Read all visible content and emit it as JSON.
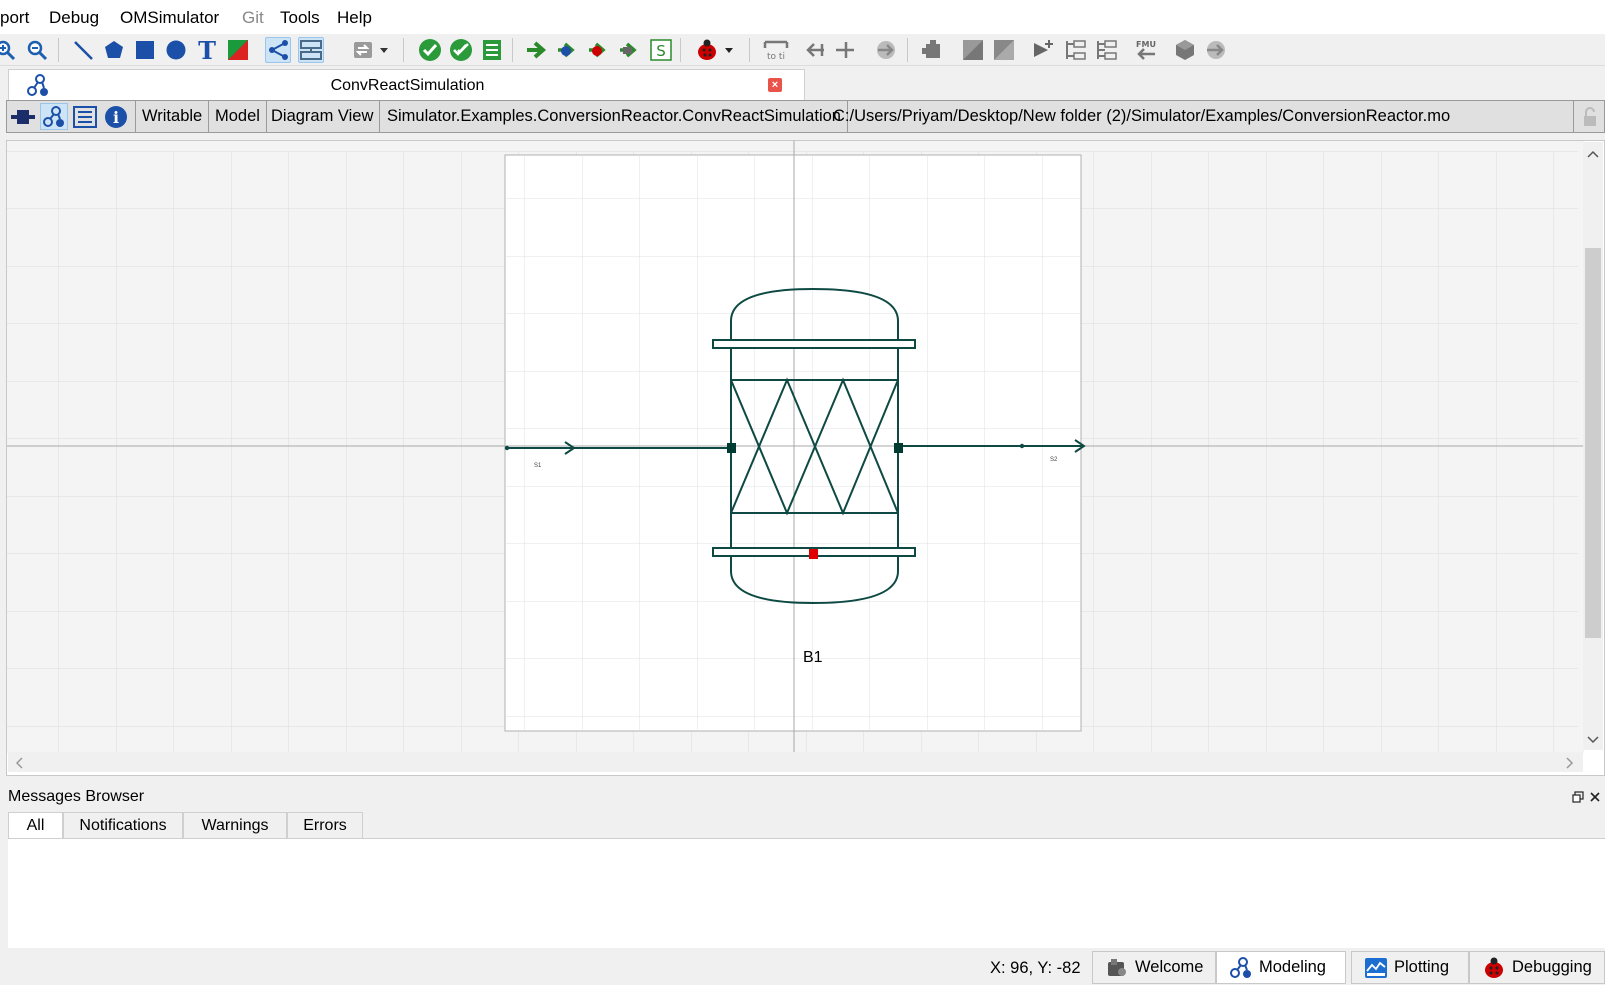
{
  "menu": {
    "items": [
      "port",
      "Debug",
      "OMSimulator",
      "Git",
      "Tools",
      "Help"
    ]
  },
  "tab": {
    "title": "ConvReactSimulation",
    "close_glyph": "×"
  },
  "infobar": {
    "access": "Writable",
    "restriction": "Model",
    "view": "Diagram View",
    "class_name": "Simulator.Examples.ConversionReactor.ConvReactSimulation",
    "file_path": "C:/Users/Priyam/Desktop/New folder (2)/Simulator/Examples/ConversionReactor.mo"
  },
  "diagram": {
    "component_label": "B1",
    "inlet_label": "S1",
    "outlet_label": "S2",
    "line_color": "#0e4a43",
    "port_color": "#003c32",
    "energy_port_color": "#e00000"
  },
  "messages": {
    "title": "Messages Browser",
    "tabs": [
      "All",
      "Notifications",
      "Warnings",
      "Errors"
    ],
    "active_tab": "All"
  },
  "status": {
    "coordinates": "X: 96, Y: -82"
  },
  "perspectives": {
    "welcome": "Welcome",
    "modeling": "Modeling",
    "plotting": "Plotting",
    "debugging": "Debugging",
    "active": "Modeling"
  }
}
